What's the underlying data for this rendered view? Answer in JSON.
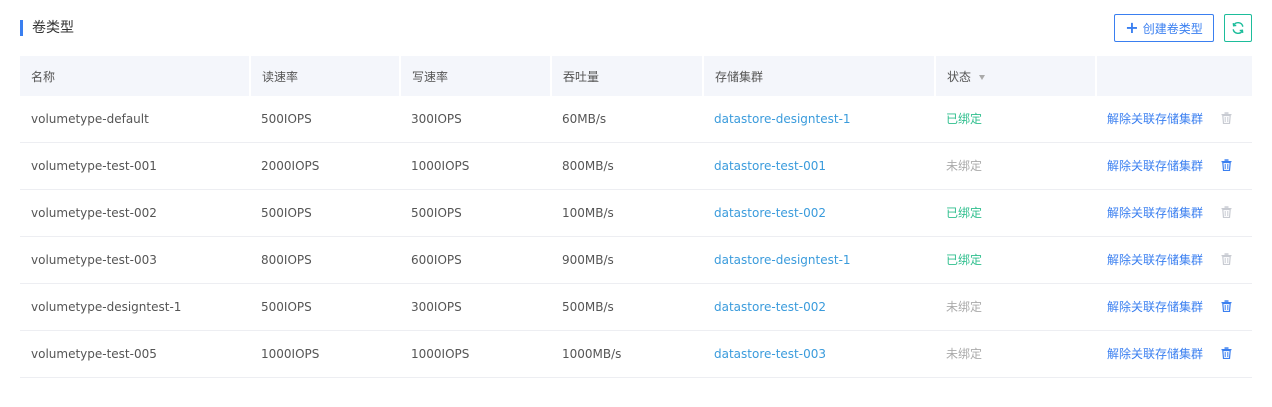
{
  "page": {
    "title": "卷类型",
    "create_label": "创建卷类型",
    "accent_color": "#3a7ff0",
    "refresh_color": "#1dbd9b"
  },
  "table": {
    "columns": [
      "名称",
      "读速率",
      "写速率",
      "吞吐量",
      "存储集群",
      "状态",
      ""
    ],
    "rows": [
      {
        "name": "volumetype-default",
        "read": "500IOPS",
        "write": "300IOPS",
        "throughput": "60MB/s",
        "cluster": "datastore-designtest-1",
        "status": "已绑定",
        "bound": true,
        "action": "解除关联存储集群",
        "delete_enabled": false
      },
      {
        "name": "volumetype-test-001",
        "read": "2000IOPS",
        "write": "1000IOPS",
        "throughput": "800MB/s",
        "cluster": "datastore-test-001",
        "status": "未绑定",
        "bound": false,
        "action": "解除关联存储集群",
        "delete_enabled": true
      },
      {
        "name": "volumetype-test-002",
        "read": "500IOPS",
        "write": "500IOPS",
        "throughput": "100MB/s",
        "cluster": "datastore-test-002",
        "status": "已绑定",
        "bound": true,
        "action": "解除关联存储集群",
        "delete_enabled": false
      },
      {
        "name": "volumetype-test-003",
        "read": "800IOPS",
        "write": "600IOPS",
        "throughput": "900MB/s",
        "cluster": "datastore-designtest-1",
        "status": "已绑定",
        "bound": true,
        "action": "解除关联存储集群",
        "delete_enabled": false
      },
      {
        "name": "volumetype-designtest-1",
        "read": "500IOPS",
        "write": "300IOPS",
        "throughput": "500MB/s",
        "cluster": "datastore-test-002",
        "status": "未绑定",
        "bound": false,
        "action": "解除关联存储集群",
        "delete_enabled": true
      },
      {
        "name": "volumetype-test-005",
        "read": "1000IOPS",
        "write": "1000IOPS",
        "throughput": "1000MB/s",
        "cluster": "datastore-test-003",
        "status": "未绑定",
        "bound": false,
        "action": "解除关联存储集群",
        "delete_enabled": true
      }
    ]
  }
}
